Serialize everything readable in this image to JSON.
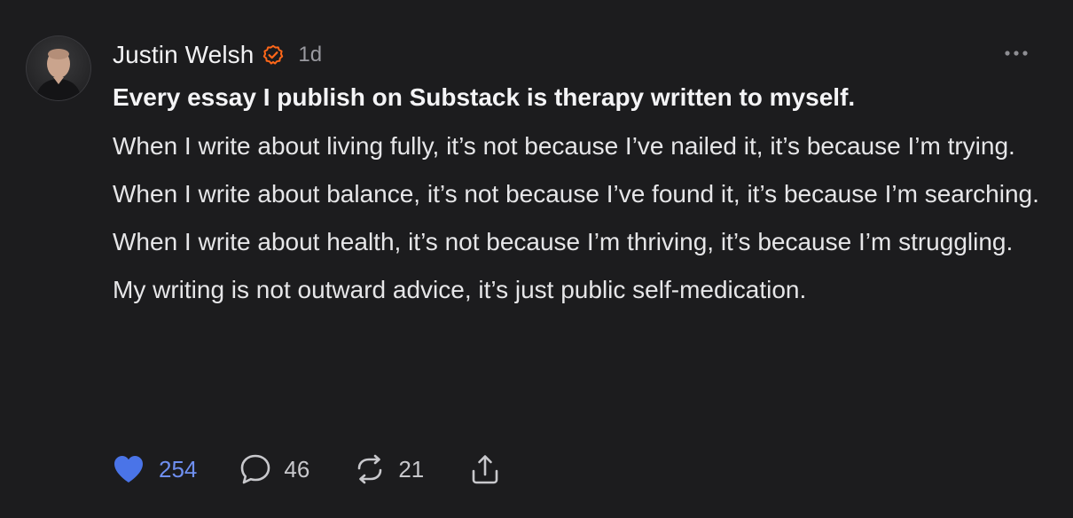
{
  "author": {
    "name": "Justin Welsh",
    "time": "1d"
  },
  "post": {
    "headline": "Every essay I publish on Substack is therapy written to myself.",
    "paragraphs": [
      "When I write about living fully, it’s not because I’ve nailed it, it’s because I’m trying.",
      "When I write about balance, it’s not because I’ve found it, it’s because I’m searching.",
      "When I write about health, it’s not because I’m thriving, it’s because I’m struggling.",
      "My writing is not outward advice, it’s just public self-medication."
    ]
  },
  "actions": {
    "likes": "254",
    "comments": "46",
    "restacks": "21"
  },
  "icons": {
    "verified": "verified-badge-icon",
    "more": "more-options-icon",
    "like": "heart-icon",
    "comment": "comment-bubble-icon",
    "restack": "restack-icon",
    "share": "share-icon"
  },
  "colors": {
    "background": "#1c1c1e",
    "accent_like": "#4a74e8",
    "verified": "#ff6719"
  }
}
